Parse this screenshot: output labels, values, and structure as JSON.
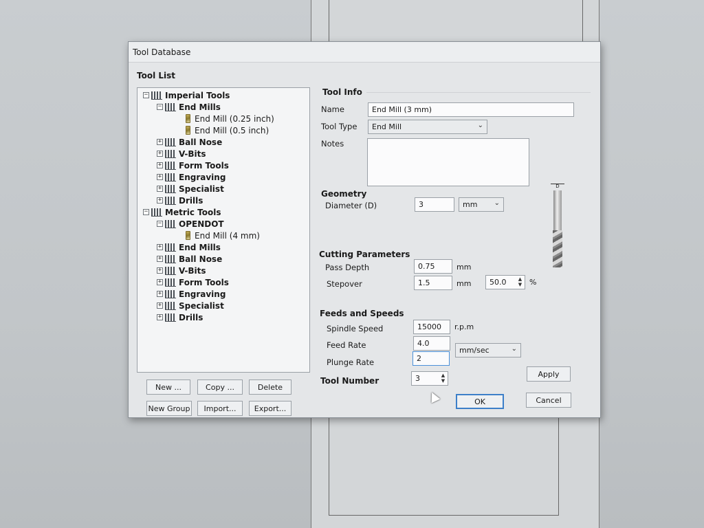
{
  "dialog": {
    "title": "Tool Database"
  },
  "tool_list": {
    "label": "Tool List",
    "tree": [
      {
        "level": 0,
        "expander": "minus",
        "label": "Imperial Tools",
        "bold": true,
        "icon": "folder-icon"
      },
      {
        "level": 1,
        "expander": "minus",
        "label": "End Mills",
        "bold": true,
        "icon": "folder-icon"
      },
      {
        "level": 2,
        "expander": "none",
        "label": "End Mill (0.25 inch)",
        "bold": false,
        "icon": "end-mill-icon"
      },
      {
        "level": 2,
        "expander": "none",
        "label": "End Mill (0.5 inch)",
        "bold": false,
        "icon": "end-mill-icon"
      },
      {
        "level": 1,
        "expander": "plus",
        "label": "Ball Nose",
        "bold": true,
        "icon": "folder-icon"
      },
      {
        "level": 1,
        "expander": "plus",
        "label": "V-Bits",
        "bold": true,
        "icon": "folder-icon"
      },
      {
        "level": 1,
        "expander": "plus",
        "label": "Form Tools",
        "bold": true,
        "icon": "folder-icon"
      },
      {
        "level": 1,
        "expander": "plus",
        "label": "Engraving",
        "bold": true,
        "icon": "folder-icon"
      },
      {
        "level": 1,
        "expander": "plus",
        "label": "Specialist",
        "bold": true,
        "icon": "folder-icon"
      },
      {
        "level": 1,
        "expander": "plus",
        "label": "Drills",
        "bold": true,
        "icon": "folder-icon"
      },
      {
        "level": 0,
        "expander": "minus",
        "label": "Metric Tools",
        "bold": true,
        "icon": "folder-icon"
      },
      {
        "level": 1,
        "expander": "minus",
        "label": "OPENDOT",
        "bold": true,
        "icon": "folder-icon"
      },
      {
        "level": 2,
        "expander": "none",
        "label": "End Mill (4 mm)",
        "bold": false,
        "icon": "end-mill-icon"
      },
      {
        "level": 1,
        "expander": "plus",
        "label": "End Mills",
        "bold": true,
        "icon": "folder-icon"
      },
      {
        "level": 1,
        "expander": "plus",
        "label": "Ball Nose",
        "bold": true,
        "icon": "folder-icon"
      },
      {
        "level": 1,
        "expander": "plus",
        "label": "V-Bits",
        "bold": true,
        "icon": "folder-icon"
      },
      {
        "level": 1,
        "expander": "plus",
        "label": "Form Tools",
        "bold": true,
        "icon": "folder-icon"
      },
      {
        "level": 1,
        "expander": "plus",
        "label": "Engraving",
        "bold": true,
        "icon": "folder-icon"
      },
      {
        "level": 1,
        "expander": "plus",
        "label": "Specialist",
        "bold": true,
        "icon": "folder-icon"
      },
      {
        "level": 1,
        "expander": "plus",
        "label": "Drills",
        "bold": true,
        "icon": "folder-icon"
      }
    ],
    "buttons": {
      "new": "New ...",
      "copy": "Copy ...",
      "delete": "Delete",
      "new_group": "New Group",
      "import": "Import...",
      "export": "Export..."
    }
  },
  "tool_info": {
    "title": "Tool Info",
    "name_label": "Name",
    "name_value": "End Mill (3 mm)",
    "type_label": "Tool Type",
    "type_value": "End Mill",
    "notes_label": "Notes",
    "notes_value": ""
  },
  "geometry": {
    "title": "Geometry",
    "diameter_label": "Diameter (D)",
    "diameter_value": "3",
    "unit_value": "mm",
    "diagram_label": "D"
  },
  "cutting": {
    "title": "Cutting Parameters",
    "pass_depth_label": "Pass Depth",
    "pass_depth_value": "0.75",
    "pass_depth_unit": "mm",
    "stepover_label": "Stepover",
    "stepover_value": "1.5",
    "stepover_unit": "mm",
    "stepover_percent_value": "50.0",
    "percent_symbol": "%"
  },
  "feeds": {
    "title": "Feeds and Speeds",
    "spindle_label": "Spindle Speed",
    "spindle_value": "15000",
    "spindle_unit": "r.p.m",
    "feed_label": "Feed Rate",
    "feed_value": "4.0",
    "rate_unit": "mm/sec",
    "plunge_label": "Plunge Rate",
    "plunge_value": "2"
  },
  "tool_number": {
    "label": "Tool Number",
    "value": "3"
  },
  "actions": {
    "apply": "Apply",
    "ok": "OK",
    "cancel": "Cancel"
  },
  "colors": {
    "dialog_bg": "#e4e6e8",
    "accent_border": "#3c7fc9",
    "focus_border": "#4a90d9"
  }
}
